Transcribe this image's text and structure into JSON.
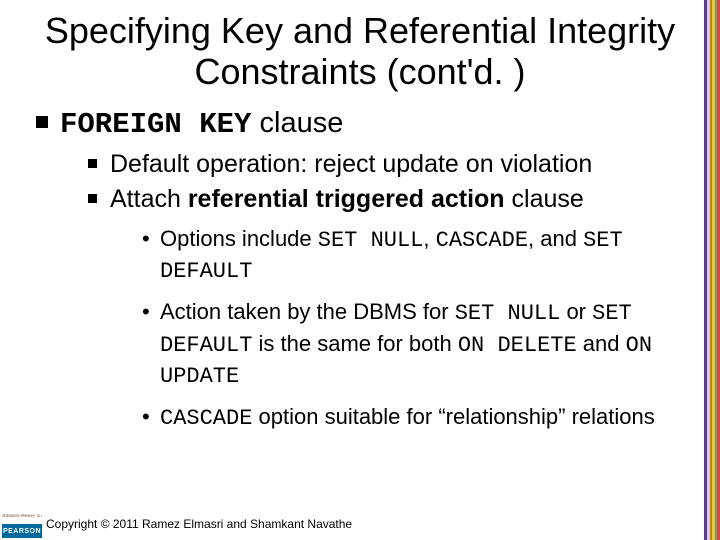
{
  "title": "Specifying Key and Referential Integrity Constraints (cont'd. )",
  "outline": {
    "b1_pre": "FOREIGN KEY",
    "b1_post": " clause",
    "l2a": "Default operation: reject update on violation",
    "l2b_pre": "Attach ",
    "l2b_bold": "referential triggered action",
    "l2b_post": " clause",
    "l3a_a": "Options include ",
    "l3a_b": "SET NULL",
    "l3a_c": ", ",
    "l3a_d": "CASCADE",
    "l3a_e": ", and ",
    "l3a_f": "SET DEFAULT",
    "l3b_a": "Action taken by the DBMS for ",
    "l3b_b": "SET NULL",
    "l3b_c": " or ",
    "l3b_d": "SET DEFAULT",
    "l3b_e": " is the same for both ",
    "l3b_f": "ON DELETE",
    "l3b_g": " and ",
    "l3b_h": "ON UPDATE",
    "l3c_a": "CASCADE",
    "l3c_b": " option suitable for “relationship” relations"
  },
  "logo": {
    "top": "Addison-Wesley is an imprint of",
    "brand": "PEARSON"
  },
  "copyright": "Copyright © 2011 Ramez Elmasri and Shamkant Navathe"
}
